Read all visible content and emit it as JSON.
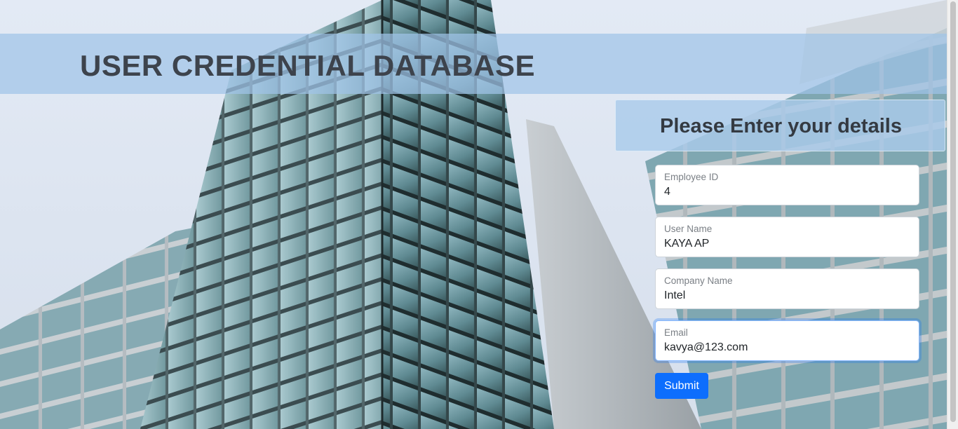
{
  "header": {
    "title": "USER CREDENTIAL DATABASE"
  },
  "form": {
    "heading": "Please Enter your details",
    "fields": [
      {
        "label": "Employee ID",
        "value": "4"
      },
      {
        "label": "User Name",
        "value": "KAYA AP"
      },
      {
        "label": "Company Name",
        "value": "Intel"
      },
      {
        "label": "Email",
        "value": "kavya@123.com"
      }
    ],
    "submit_label": "Submit"
  },
  "colors": {
    "accent": "#0d6efd",
    "banner": "#a0c4e8",
    "title_text": "#3d434c"
  },
  "background": {
    "subject": "glass-office-tower-photo"
  }
}
